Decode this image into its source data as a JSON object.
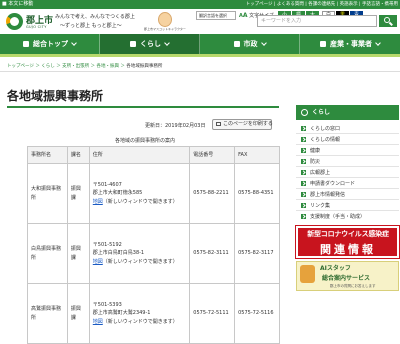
{
  "topbar": {
    "skip_link": "■ 本文に移動",
    "links": "トップページ | よくある質問 | 各課の連絡先 | 英語表示 | 手話言語・携帯用"
  },
  "header": {
    "city_name": "郡上市",
    "city_roman": "GUJO CITY",
    "slogan_line1": "みんなで考え、みんなでつくる郡上",
    "slogan_line2": "〜ずっと郡上 もっと郡上〜",
    "mascot_caption": "郡上市マスコットキャラクター",
    "lang_select": "翻訳言語を選択",
    "text_size_label": "文字サイズ",
    "font_sizes": [
      "小",
      "標",
      "大"
    ],
    "color_options": [
      "白",
      "黒",
      "青"
    ],
    "search_placeholder": "キーワードを入力"
  },
  "nav": {
    "items": [
      {
        "label": "総合トップ"
      },
      {
        "label": "くらし"
      },
      {
        "label": "市政"
      },
      {
        "label": "産業・事業者"
      }
    ]
  },
  "breadcrumb": {
    "path": "トップページ ＞ くらし ＞ 支所・出張所 ＞ 各地・振興 ＞",
    "current": "各地域振興事務所"
  },
  "main": {
    "title": "各地域振興事務所",
    "updated": "更新日：2019年02月03日",
    "print_label": "このページを印刷する",
    "table_caption": "各地域の振興事務所の案内",
    "table": {
      "headers": [
        "事務所名",
        "課名",
        "住所",
        "電話番号",
        "FAX"
      ],
      "rows": [
        {
          "office": "大和振興事務所",
          "section": "振興課",
          "postal": "〒501-4607",
          "address": "郡上市大和町徳永585",
          "map_link": "地図",
          "map_note": "（新しいウィンドウで開きます）",
          "phone": "0575-88-2211",
          "fax": "0575-88-4351"
        },
        {
          "office": "白鳥振興事務所",
          "section": "振興課",
          "postal": "〒501-5192",
          "address": "郡上市白鳥町白鳥38-1",
          "map_link": "地図",
          "map_note": "（新しいウィンドウで開きます）",
          "phone": "0575-82-3111",
          "fax": "0575-82-3117"
        },
        {
          "office": "高鷲振興事務所",
          "section": "振興課",
          "postal": "〒501-5393",
          "address": "郡上市高鷲町大鷲2349-1",
          "map_link": "地図",
          "map_note": "（新しいウィンドウで開きます）",
          "phone": "0575-72-5111",
          "fax": "0575-72-5116"
        }
      ]
    }
  },
  "sidebar": {
    "heading": "くらし",
    "items": [
      {
        "label": "くらしの窓口"
      },
      {
        "label": "くらしの情報"
      },
      {
        "label": "健康"
      },
      {
        "label": "防災"
      },
      {
        "label": "広報郡上"
      },
      {
        "label": "申請書ダウンロード"
      },
      {
        "label": "郡上市情報発信"
      },
      {
        "label": "リンク集"
      },
      {
        "label": "支援制度（手当・助成）"
      }
    ],
    "covid_line1": "新型コロナウイルス感染症",
    "covid_line2": "関連情報",
    "ai_line1": "AIスタッフ",
    "ai_line2": "総合案内サービス",
    "ai_line3": "郡上市の質問にお答えします"
  },
  "colors": {
    "brand_green": "#2e8b3e",
    "nav_active": "#246f31",
    "accent_lime": "#b7d96c",
    "covid_red": "#c8141e"
  }
}
